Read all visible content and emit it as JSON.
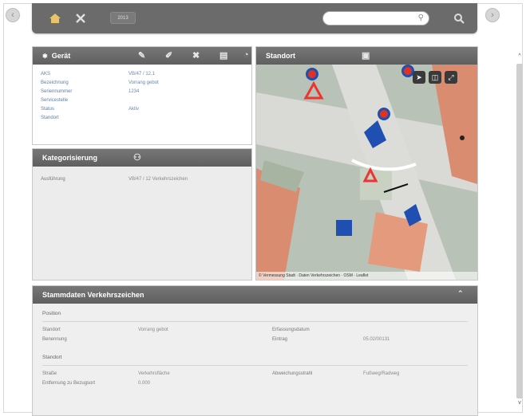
{
  "nav": {
    "back_icon": "chevron-left-icon",
    "forward_icon": "chevron-right-icon"
  },
  "toolbar": {
    "tag_label": "2013",
    "search_placeholder": "",
    "icons": [
      "home-icon",
      "tools-icon",
      "search-icon",
      "zoom-icon"
    ],
    "accent": "#e7c36a"
  },
  "geraet": {
    "title": "Gerät",
    "rows": [
      {
        "label": "AKS",
        "value": "VB/47 / 12.1"
      },
      {
        "label": "Bezeichnung",
        "value": "Vorrang gebot"
      },
      {
        "label": "Seriennummer",
        "value": "1234"
      },
      {
        "label": "Servicestelle",
        "value": ""
      },
      {
        "label": "Status",
        "value": "Aktiv"
      },
      {
        "label": "Standort",
        "value": ""
      }
    ]
  },
  "kategorisierung": {
    "title": "Kategorisierung",
    "rows": [
      {
        "label": "Ausführung",
        "value": "VB/47 / 12 Verkehrszeichen"
      }
    ]
  },
  "standort": {
    "title": "Standort",
    "attribution": "© Vermessung Stadt · Daten Verkehrszeichen · OSM · Leaflet"
  },
  "stammdaten": {
    "title": "Stammdaten Verkehrszeichen",
    "section1": {
      "title": "Position",
      "rows": [
        {
          "l1": "Standort",
          "v1": "Vorrang gebot",
          "l2": "Erfassungsdatum",
          "v2": ""
        },
        {
          "l1": "Benennung",
          "v1": "",
          "l2": "Eintrag",
          "v2": "05.02/00131"
        }
      ]
    },
    "section2": {
      "title": "Standort",
      "rows": [
        {
          "l1": "Straße",
          "v1": "Verkehrsfläche",
          "l2": "Abweichungsstrahl",
          "v2": "Fußweg/Radweg"
        },
        {
          "l1": "Entfernung zu Bezugsort",
          "v1": "0.000",
          "l2": "",
          "v2": ""
        }
      ]
    }
  }
}
